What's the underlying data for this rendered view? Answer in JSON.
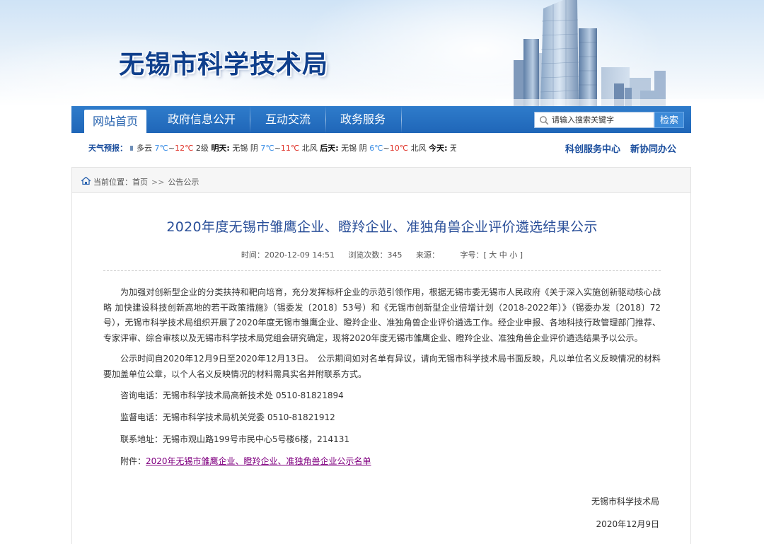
{
  "site": {
    "title": "无锡市科学技术局"
  },
  "nav": {
    "items": [
      {
        "label": "网站首页",
        "active": true
      },
      {
        "label": "政府信息公开",
        "active": false
      },
      {
        "label": "互动交流",
        "active": false
      },
      {
        "label": "政务服务",
        "active": false
      }
    ],
    "search_placeholder": "请输入搜索关键字",
    "search_button": "检索"
  },
  "weather": {
    "label": "天气预报：",
    "segments": [
      {
        "text": "多云 "
      },
      {
        "text": "7℃",
        "cls": "t-low"
      },
      {
        "text": "~"
      },
      {
        "text": "12℃",
        "cls": "t-high"
      },
      {
        "text": " 2级 "
      },
      {
        "text": "明天:",
        "cls": "wlabel"
      },
      {
        "text": " 无锡 阴 "
      },
      {
        "text": "7℃",
        "cls": "t-low"
      },
      {
        "text": "~"
      },
      {
        "text": "11℃",
        "cls": "t-high"
      },
      {
        "text": " 北风 "
      },
      {
        "text": "后天:",
        "cls": "wlabel"
      },
      {
        "text": " 无锡 阴 "
      },
      {
        "text": "6℃",
        "cls": "t-low"
      },
      {
        "text": "~"
      },
      {
        "text": "10℃",
        "cls": "t-high"
      },
      {
        "text": " 北风 "
      },
      {
        "text": "今天:",
        "cls": "wlabel"
      },
      {
        "text": " 无"
      }
    ],
    "links": [
      "科创服务中心",
      "新协同办公"
    ]
  },
  "breadcrumb": {
    "prefix": "当前位置：",
    "home": "首页",
    "separator": ">>",
    "current": "公告公示"
  },
  "article": {
    "title": "2020年度无锡市雏鹰企业、瞪羚企业、准独角兽企业评价遴选结果公示",
    "meta": {
      "time_label": "时间：",
      "time": "2020-12-09 14:51",
      "views_label": "浏览次数：",
      "views": "345",
      "source_label": "来源：",
      "source": "",
      "font_label": "字号：",
      "font_options": "[ 大 中 小 ]"
    },
    "paragraphs": [
      "为加强对创新型企业的分类扶持和靶向培育，充分发挥标杆企业的示范引领作用，根据无锡市委无锡市人民政府《关于深入实施创新驱动核心战略 加快建设科技创新高地的若干政策措施》（锡委发〔2018〕53号）和《无锡市创新型企业倍增计划（2018-2022年）》（锡委办发〔2018〕72号），无锡市科学技术局组织开展了2020年度无锡市雏鹰企业、瞪羚企业、准独角兽企业评价遴选工作。经企业申报、各地科技行政管理部门推荐、专家评审、综合审核以及无锡市科学技术局党组会研究确定，现将2020年度无锡市雏鹰企业、瞪羚企业、准独角兽企业评价遴选结果予以公示。",
      "公示时间自2020年12月9日至2020年12月13日。　公示期间如对名单有异议，请向无锡市科学技术局书面反映，凡以单位名义反映情况的材料要加盖单位公章，以个人名义反映情况的材料需具实名并附联系方式。"
    ],
    "contacts": [
      "咨询电话：无锡市科学技术局高新技术处 0510-81821894",
      "监督电话：无锡市科学技术局机关党委 0510-81821912",
      "联系地址：无锡市观山路199号市民中心5号楼6楼，214131"
    ],
    "attachment_label": "附件：",
    "attachment_link": "2020年无锡市雏鹰企业、瞪羚企业、准独角兽企业公示名单",
    "signature_org": "无锡市科学技术局",
    "signature_date": "2020年12月9日"
  },
  "colors": {
    "nav_blue": "#2470c2",
    "title_blue": "#2a4f99",
    "link_purple": "#800080",
    "temp_low": "#3a8ee6",
    "temp_high": "#e0352b"
  }
}
